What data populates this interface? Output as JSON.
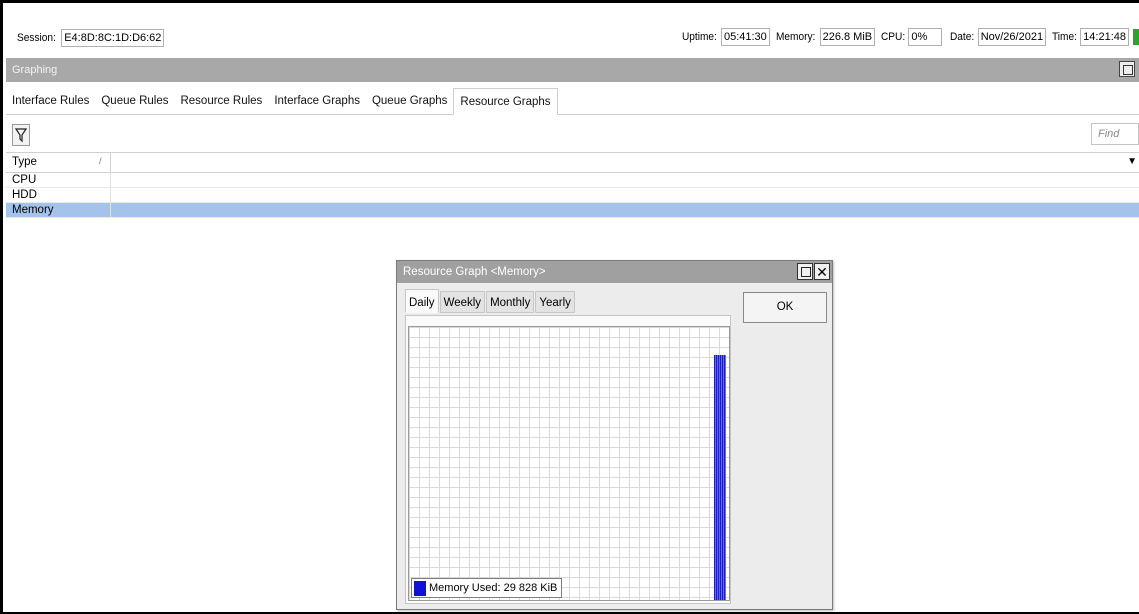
{
  "status": {
    "session_label": "Session:",
    "session_value": "E4:8D:8C:1D:D6:62",
    "uptime_label": "Uptime:",
    "uptime_value": "05:41:30",
    "memory_label": "Memory:",
    "memory_value": "226.8 MiB",
    "cpu_label": "CPU:",
    "cpu_value": "0%",
    "date_label": "Date:",
    "date_value": "Nov/26/2021",
    "time_label": "Time:",
    "time_value": "14:21:48"
  },
  "window": {
    "title": "Graphing"
  },
  "tabs": [
    {
      "label": "Interface Rules"
    },
    {
      "label": "Queue Rules"
    },
    {
      "label": "Resource Rules"
    },
    {
      "label": "Interface Graphs"
    },
    {
      "label": "Queue Graphs"
    },
    {
      "label": "Resource Graphs",
      "active": true
    }
  ],
  "toolbar": {
    "find_placeholder": "Find"
  },
  "table": {
    "column_type": "Type",
    "rows": [
      {
        "type": "CPU"
      },
      {
        "type": "HDD"
      },
      {
        "type": "Memory",
        "selected": true
      }
    ]
  },
  "dialog": {
    "title": "Resource Graph <Memory>",
    "tabs": [
      {
        "label": "Daily",
        "active": true
      },
      {
        "label": "Weekly"
      },
      {
        "label": "Monthly"
      },
      {
        "label": "Yearly"
      }
    ],
    "ok_label": "OK",
    "legend": "Memory Used: 29 828 KiB",
    "legend_color": "#1010d8"
  },
  "colors": {
    "selected_row": "#a4c3ea",
    "title_bar": "#a8a8a8",
    "status_led": "#2aa52a"
  }
}
